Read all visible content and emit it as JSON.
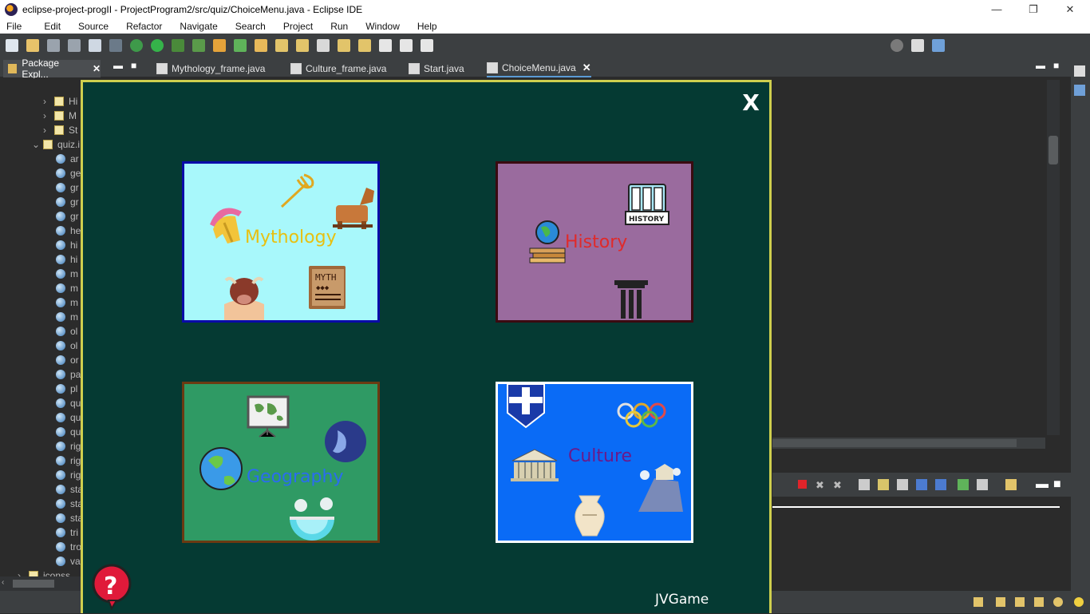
{
  "window": {
    "title": "eclipse-project-progII - ProjectProgram2/src/quiz/ChoiceMenu.java - Eclipse IDE",
    "controls": [
      "—",
      "❐",
      "✕"
    ]
  },
  "menubar": [
    "File",
    "Edit",
    "Source",
    "Refactor",
    "Navigate",
    "Search",
    "Project",
    "Run",
    "Window",
    "Help"
  ],
  "package_explorer": {
    "tab_label": "Package Expl...",
    "rows": [
      "Hi",
      "M",
      "St",
      "quiz.i",
      "ar",
      "ge",
      "gr",
      "gr",
      "gr",
      "he",
      "hi",
      "hi",
      "m",
      "m",
      "m",
      "m",
      "ol",
      "ol",
      "or",
      "pa",
      "pl",
      "qu",
      "qu",
      "qu",
      "rig",
      "rig",
      "rig",
      "sta",
      "sta",
      "sta",
      "tri",
      "tro",
      "va",
      "iconss"
    ]
  },
  "editor_tabs": [
    {
      "label": "Mythology_frame.java",
      "active": false
    },
    {
      "label": "Culture_frame.java",
      "active": false
    },
    {
      "label": "Start.java",
      "active": false
    },
    {
      "label": "ChoiceMenu.java",
      "active": true
    }
  ],
  "game_frame": {
    "close_label": "X",
    "brand": "JVGame",
    "help_symbol": "?",
    "cards": {
      "mythology": {
        "label": "Mythology",
        "bg": "#a8f8fb",
        "text_color": "#e8c010",
        "myth_book": "MYTH"
      },
      "history": {
        "label": "History",
        "bg": "#9a6b9e",
        "text_color": "#e02a2a",
        "book_label": "HISTORY"
      },
      "geography": {
        "label": "Geography",
        "bg": "#2f9a64",
        "text_color": "#2a6cf0"
      },
      "culture": {
        "label": "Culture",
        "bg": "#0a6bf6",
        "text_color": "#6a1a8a"
      }
    }
  },
  "colors": {
    "frame_bg": "#053a33",
    "frame_border": "#cfcf4e",
    "ide_bg": "#2b2b2b",
    "ide_panel": "#3c3f41"
  }
}
